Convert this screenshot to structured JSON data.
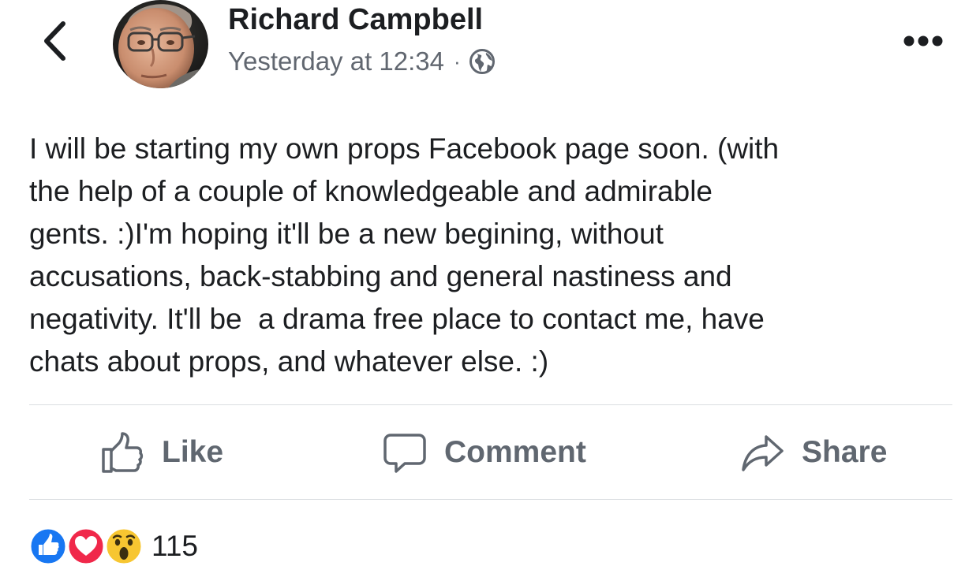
{
  "header": {
    "back_icon": "chevron-left-icon",
    "author_name": "Richard Campbell",
    "timestamp": "Yesterday at 12:34",
    "separator": "·",
    "privacy_icon": "globe-icon",
    "more_icon": "more-horizontal-icon"
  },
  "post": {
    "text": "I will be starting my own props Facebook page soon. (with\nthe help of a couple of knowledgeable and admirable\ngents. :)I'm hoping it'll be a new begining, without\naccusations, back-stabbing and general nastiness and\nnegativity. It'll be  a drama free place to contact me, have\nchats about props, and whatever else. :)"
  },
  "actions": {
    "like_label": "Like",
    "comment_label": "Comment",
    "share_label": "Share"
  },
  "reactions": {
    "types": [
      "like",
      "love",
      "wow"
    ],
    "count": "115"
  },
  "colors": {
    "text": "#1c1e21",
    "secondary_text": "#616770",
    "action_text": "#606770",
    "like_blue": "#1877f2",
    "love_red": "#f0284a",
    "wow_yellow": "#f7c631",
    "divider": "#dadde1"
  }
}
